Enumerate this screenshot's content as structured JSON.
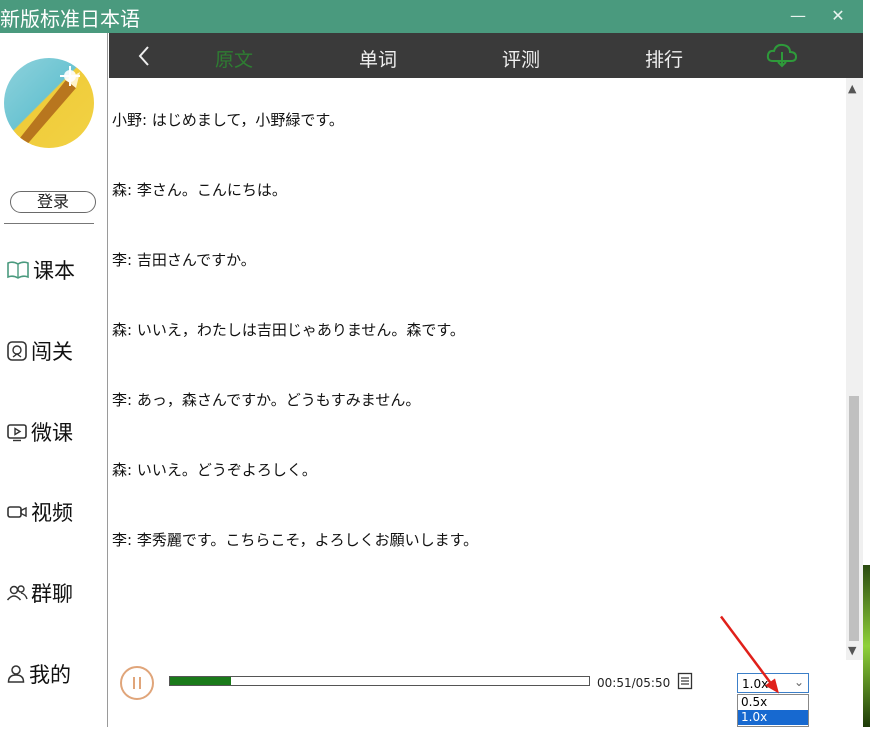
{
  "window": {
    "title": "新版标准日本语",
    "min_glyph": "—",
    "close_glyph": "✕"
  },
  "sidebar": {
    "login_label": "登录",
    "items": [
      {
        "label": "课本",
        "icon": "book-icon"
      },
      {
        "label": "闯关",
        "icon": "badge-icon"
      },
      {
        "label": "微课",
        "icon": "play-screen-icon"
      },
      {
        "label": "视频",
        "icon": "video-camera-icon"
      },
      {
        "label": "群聊",
        "icon": "group-icon"
      },
      {
        "label": "我的",
        "icon": "person-icon"
      }
    ]
  },
  "tabs": [
    {
      "label": "原文",
      "active": true
    },
    {
      "label": "单词",
      "active": false
    },
    {
      "label": "评测",
      "active": false
    },
    {
      "label": "排行",
      "active": false
    }
  ],
  "colors": {
    "titlebar": "#4a9a7e",
    "tabbar": "#3a3a3a",
    "active_tab": "#2e7d32",
    "progress": "#1a7a1a"
  },
  "dialogue": [
    "小野: はじめまして，小野緑です。",
    "森: 李さん。こんにちは。",
    "李: 吉田さんですか。",
    "森: いいえ，わたしは吉田じゃありません。森です。",
    "李: あっ，森さんですか。どうもすみません。",
    "森: いいえ。どうぞよろしく。",
    "李: 李秀麗です。こちらこそ，よろしくお願いします。"
  ],
  "player": {
    "time": "00:51/05:50",
    "progress_fraction": 0.145,
    "speed_selected": "1.0x",
    "speed_options": [
      "0.5x",
      "1.0x"
    ]
  }
}
